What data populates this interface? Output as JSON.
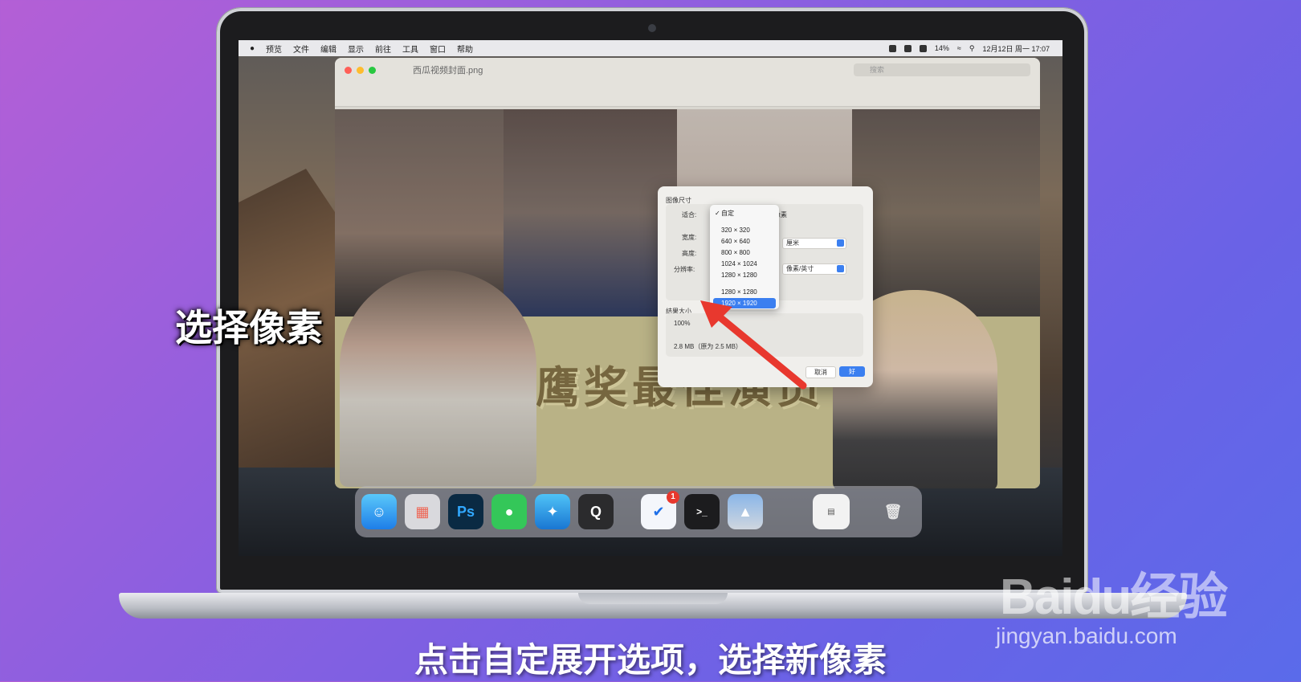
{
  "menubar": {
    "items": [
      "预览",
      "文件",
      "编辑",
      "显示",
      "前往",
      "工具",
      "窗口",
      "帮助"
    ],
    "battery": "14%",
    "datetime": "12月12日 周一 17:07"
  },
  "window": {
    "title": "西瓜视频封面.png",
    "search_placeholder": "搜索"
  },
  "banner": {
    "title": "金鹰奖最佳演员"
  },
  "dialog": {
    "section_title": "图像尺寸",
    "fit_label": "适合:",
    "width_label": "宽度:",
    "height_label": "高度:",
    "resolution_label": "分辨率:",
    "unit_pixels": "像素",
    "unit_cm": "厘米",
    "unit_ppi": "像素/英寸",
    "result_title": "结果大小",
    "result_percent": "100%",
    "result_size": "2.8 MB（原为 2.5 MB）",
    "cancel": "取消",
    "ok": "好"
  },
  "dropdown": {
    "checked": "自定",
    "options": [
      "320 × 320",
      "640 × 640",
      "800 × 800",
      "1024 × 1024",
      "1280 × 1280",
      "1280 × 1280",
      "1920 × 1920"
    ]
  },
  "dock": {
    "ps_label": "Ps",
    "mail_badge": "1"
  },
  "overlay": {
    "side_caption": "选择像素",
    "bottom_caption": "点击自定展开选项，选择新像素",
    "watermark_logo": "Baidu经验",
    "watermark_url": "jingyan.baidu.com"
  },
  "colors": {
    "accent": "#3b7ff0",
    "arrow": "#e8382e",
    "background_start": "#b45fd6",
    "background_end": "#5a6bea"
  }
}
